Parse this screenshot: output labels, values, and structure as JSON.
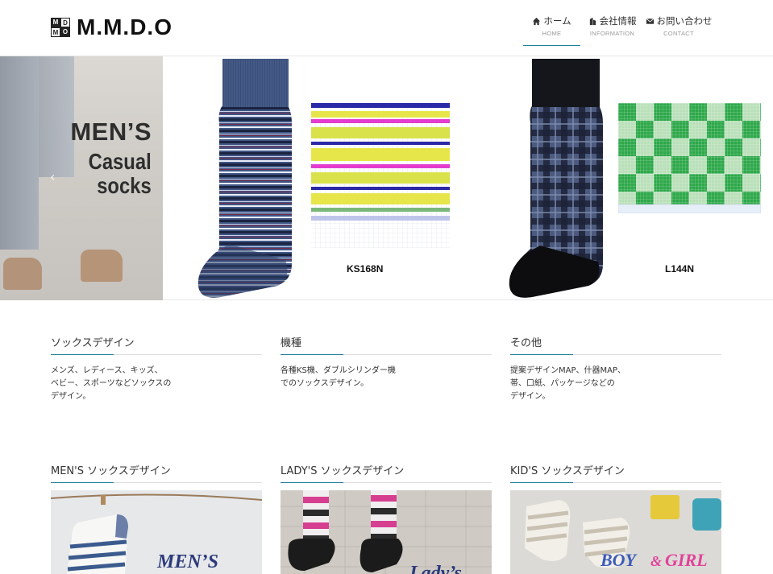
{
  "header": {
    "logo_mark": [
      "M",
      "D",
      "M",
      "O"
    ],
    "logo_text": "M.M.D.O",
    "nav": [
      {
        "label": "ホーム",
        "sub": "HOME",
        "icon": "home-icon",
        "active": true
      },
      {
        "label": "会社情報",
        "sub": "INFORMATION",
        "icon": "building-icon",
        "active": false
      },
      {
        "label": "お問い合わせ",
        "sub": "CONTACT",
        "icon": "mail-icon",
        "active": false
      }
    ]
  },
  "hero": {
    "title_line1": "MEN’S",
    "title_line2": "Casual",
    "title_line3": "socks",
    "prev_arrow": "‹",
    "product1_code": "KS168N",
    "product2_code": "L144N"
  },
  "features": [
    {
      "title": "ソックスデザイン",
      "text": "メンズ、レディース、キッズ、\nベビー、スポーツなどソックスの\nデザイン。"
    },
    {
      "title": "機種",
      "text": "各種KS機、ダブルシリンダー機\nでのソックスデザイン。"
    },
    {
      "title": "その他",
      "text": "提案デザインMAP、什器MAP、\n帯、口紙、パッケージなどの\nデザイン。"
    }
  ],
  "categories": [
    {
      "title": "MEN'S ソックスデザイン",
      "overlay": "MEN’S"
    },
    {
      "title": "LADY'S ソックスデザイン",
      "overlay": "Lady’s"
    },
    {
      "title": "KID'S ソックスデザイン",
      "overlay_a": "BOY",
      "overlay_amp": "&",
      "overlay_b": "GIRL"
    }
  ],
  "colors": {
    "accent": "#1f7f99",
    "overlay_blue": "#2b3a7a",
    "overlay_pink": "#e0429a"
  }
}
